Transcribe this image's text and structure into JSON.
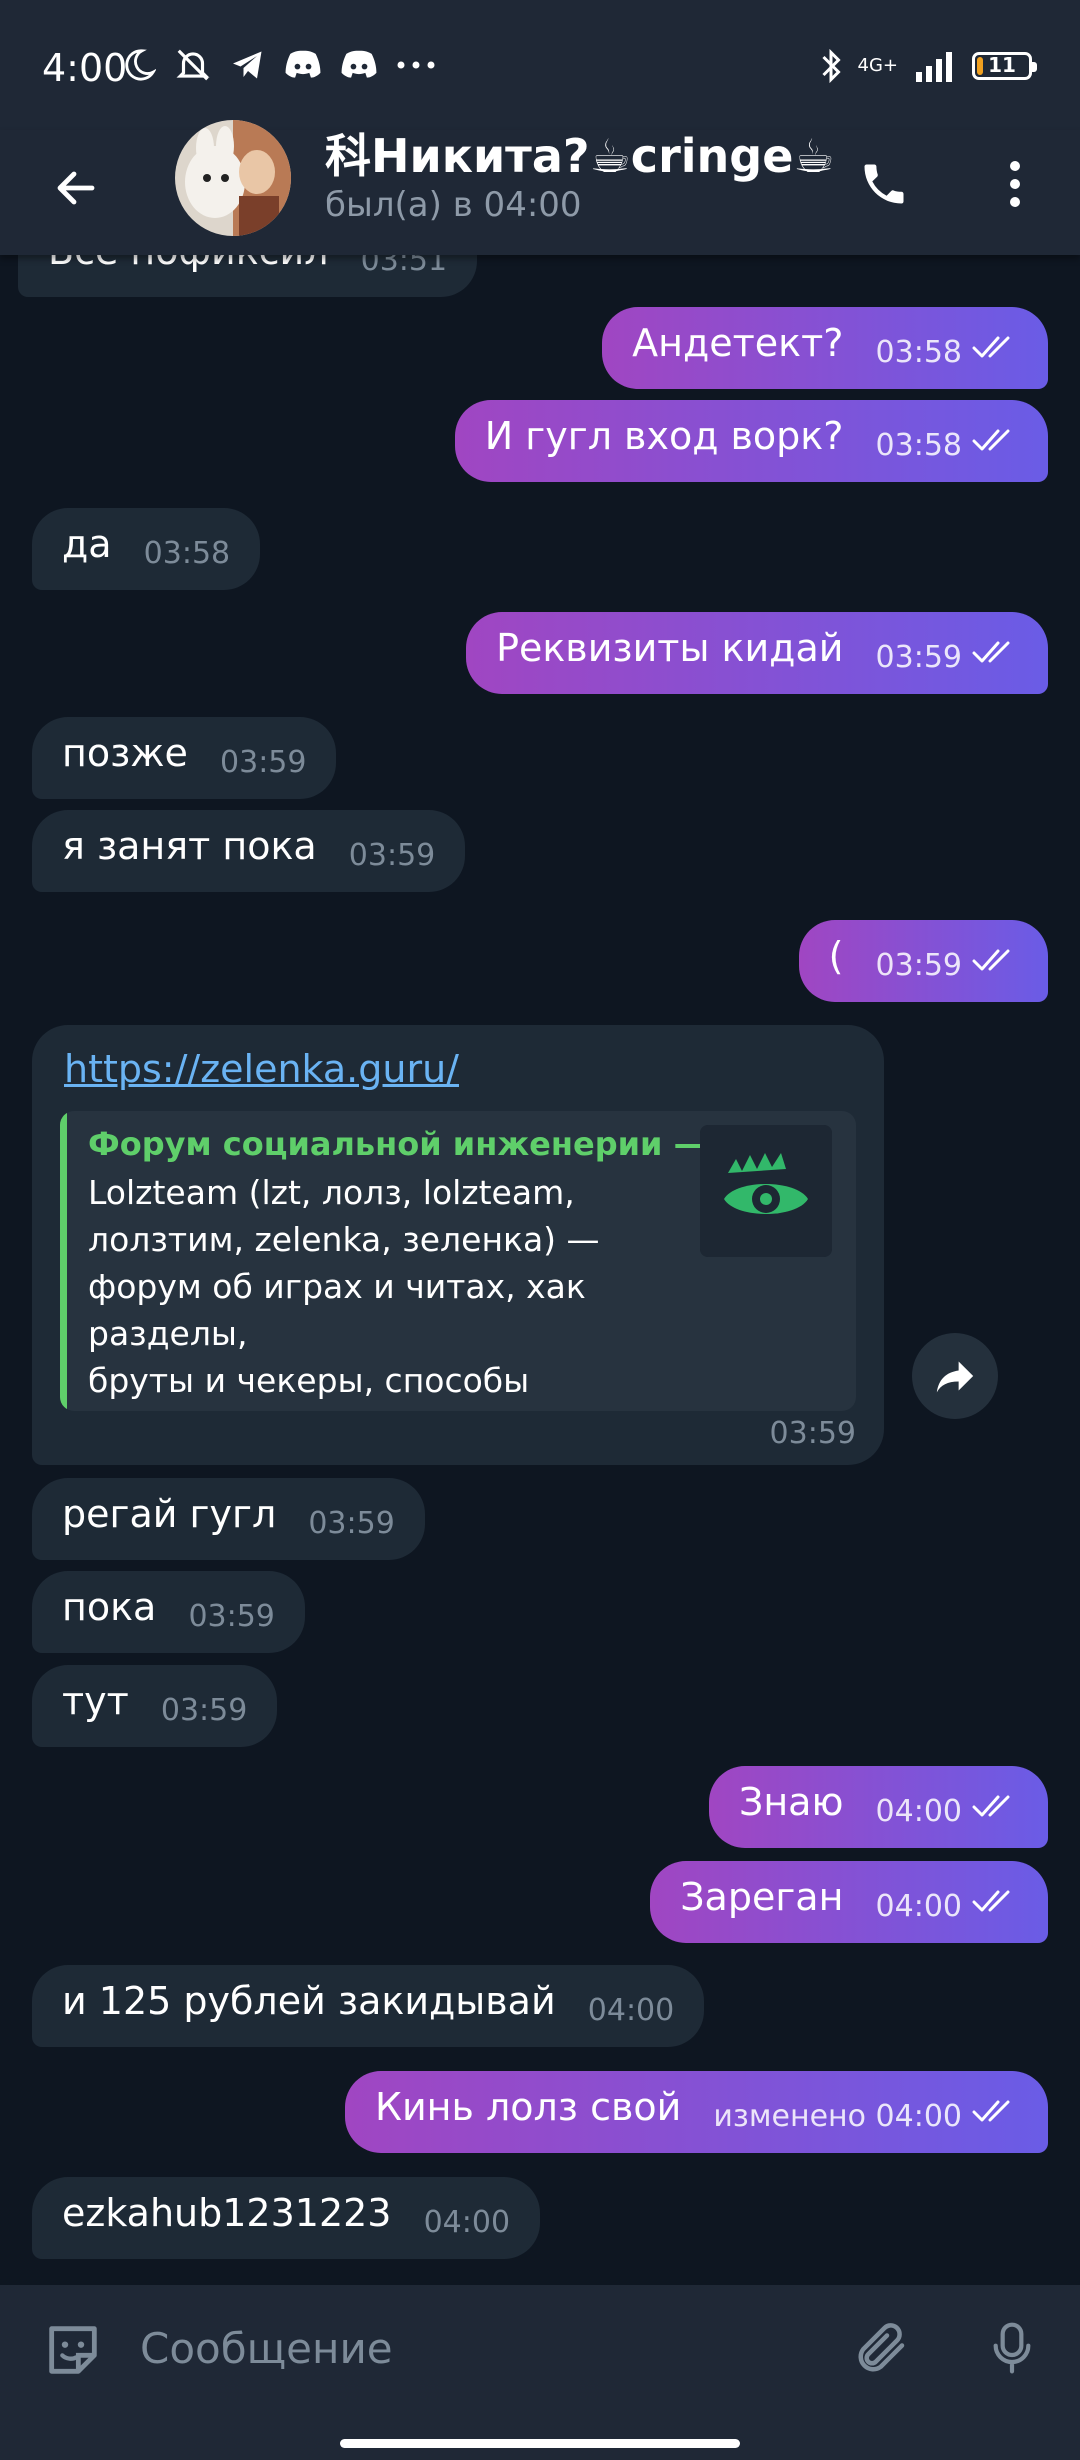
{
  "status_bar": {
    "time": "4:00",
    "network": "4G+",
    "battery": "11",
    "battery_level": 0.11,
    "battery_color": "#f0a020"
  },
  "header": {
    "name": "科Никита?☕cringe☕",
    "status": "был(а) в 04:00"
  },
  "colors": {
    "incoming": "#1e2a36",
    "outgoing_start": "#a046c2",
    "outgoing_end": "#6a5ce6",
    "link": "#6ab3f3",
    "preview_accent": "#5fcf6a"
  },
  "messages": [
    {
      "text": "Всё пофиксил",
      "time": "03:51",
      "out": false
    },
    {
      "text": "Андетект?",
      "time": "03:58",
      "out": true
    },
    {
      "text": "И гугл вход ворк?",
      "time": "03:58",
      "out": true
    },
    {
      "text": "да",
      "time": "03:58",
      "out": false
    },
    {
      "text": "Реквизиты кидай",
      "time": "03:59",
      "out": true
    },
    {
      "text": "позже",
      "time": "03:59",
      "out": false
    },
    {
      "text": "я занят пока",
      "time": "03:59",
      "out": false
    },
    {
      "text": "(",
      "time": "03:59",
      "out": true
    },
    {
      "text": "регай гугл",
      "time": "03:59",
      "out": false
    },
    {
      "text": "пока",
      "time": "03:59",
      "out": false
    },
    {
      "text": "тут",
      "time": "03:59",
      "out": false
    },
    {
      "text": "Знаю",
      "time": "04:00",
      "out": true
    },
    {
      "text": "Зареган",
      "time": "04:00",
      "out": true
    },
    {
      "text": "и 125 рублей закидывай",
      "time": "04:00",
      "out": false
    },
    {
      "text": "Кинь лолз свой",
      "time": "изменено 04:00",
      "out": true
    },
    {
      "text": "ezkahub1231223",
      "time": "04:00",
      "out": false
    }
  ],
  "link_message": {
    "url": "https://zelenka.guru/",
    "preview_title": "Форум социальной инженерии —...",
    "preview_description": "Lolzteam (lzt, лолз, lolzteam,\nлолзтим, zelenka, зеленка) —\nфорум об играх и читах, хак разделы,\nбруты и чекеры, способы заработка и\nраздачи баз",
    "time": "03:59"
  },
  "input": {
    "placeholder": "Сообщение"
  }
}
